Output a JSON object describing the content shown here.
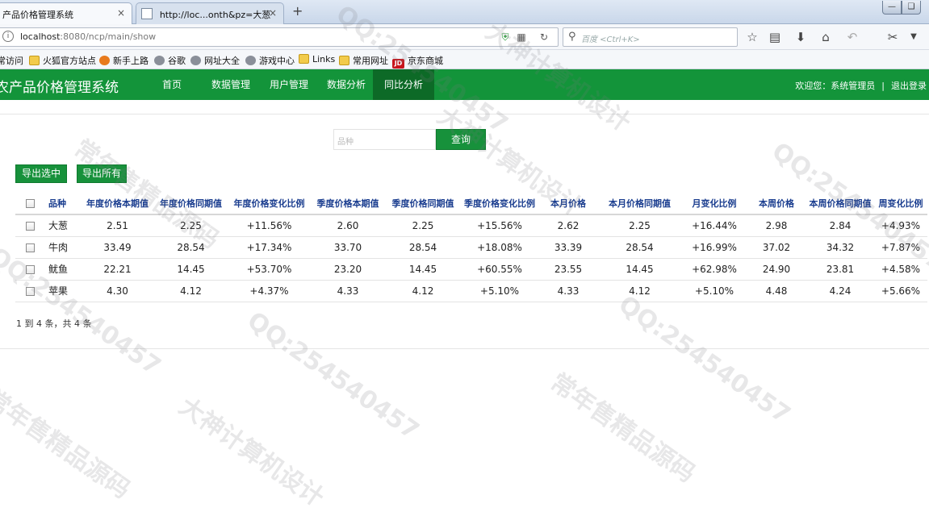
{
  "browser": {
    "tabs": [
      {
        "title": "产品价格管理系统",
        "active": true
      },
      {
        "title": "http://loc...onth&pz=大葱",
        "active": false
      }
    ],
    "new_tab": "+",
    "close_glyph": "×",
    "url_host": "localhost",
    "url_rest": ":8080/ncp/main/show",
    "search_placeholder": "百度 <Ctrl+K>",
    "bookmarks": [
      {
        "label": "常访问",
        "icon": "none"
      },
      {
        "label": "火狐官方站点",
        "icon": "folder"
      },
      {
        "label": "新手上路",
        "icon": "fox"
      },
      {
        "label": "谷歌",
        "icon": "globe"
      },
      {
        "label": "网址大全",
        "icon": "globe"
      },
      {
        "label": "游戏中心",
        "icon": "globe"
      },
      {
        "label": "Links",
        "icon": "folder"
      },
      {
        "label": "常用网址",
        "icon": "folder"
      },
      {
        "label": "京东商城",
        "icon": "jd"
      }
    ],
    "jd_badge": "JD"
  },
  "app": {
    "title": "农产品价格管理系统",
    "nav": [
      {
        "label": "首页",
        "active": false
      },
      {
        "label": "数据管理",
        "active": false
      },
      {
        "label": "用户管理",
        "active": false
      },
      {
        "label": "数据分析",
        "active": false
      },
      {
        "label": "同比分析",
        "active": true
      }
    ],
    "welcome": "欢迎您：系统管理员",
    "welcome_sep": "|",
    "logout": "退出登录",
    "accent_color": "#13943a"
  },
  "toolbar": {
    "search_placeholder": "品种",
    "query_label": "查询",
    "export_selected_label": "导出选中",
    "export_all_label": "导出所有"
  },
  "table": {
    "headers": [
      "品种",
      "年度价格本期值",
      "年度价格同期值",
      "年度价格变化比例",
      "季度价格本期值",
      "季度价格同期值",
      "季度价格变化比例",
      "本月价格",
      "本月价格同期值",
      "月变化比例",
      "本周价格",
      "本周价格同期值",
      "周变化比例"
    ],
    "rows": [
      [
        "大葱",
        "2.51",
        "2.25",
        "+11.56%",
        "2.60",
        "2.25",
        "+15.56%",
        "2.62",
        "2.25",
        "+16.44%",
        "2.98",
        "2.84",
        "+4.93%"
      ],
      [
        "牛肉",
        "33.49",
        "28.54",
        "+17.34%",
        "33.70",
        "28.54",
        "+18.08%",
        "33.39",
        "28.54",
        "+16.99%",
        "37.02",
        "34.32",
        "+7.87%"
      ],
      [
        "鱿鱼",
        "22.21",
        "14.45",
        "+53.70%",
        "23.20",
        "14.45",
        "+60.55%",
        "23.55",
        "14.45",
        "+62.98%",
        "24.90",
        "23.81",
        "+4.58%"
      ],
      [
        "苹果",
        "4.30",
        "4.12",
        "+4.37%",
        "4.33",
        "4.12",
        "+5.10%",
        "4.33",
        "4.12",
        "+5.10%",
        "4.48",
        "4.24",
        "+5.66%"
      ]
    ],
    "pager": "1 到 4 条，共 4 条"
  },
  "watermarks": [
    "常年售精品源码",
    "大神计算机设计",
    "QQ:254540457"
  ]
}
